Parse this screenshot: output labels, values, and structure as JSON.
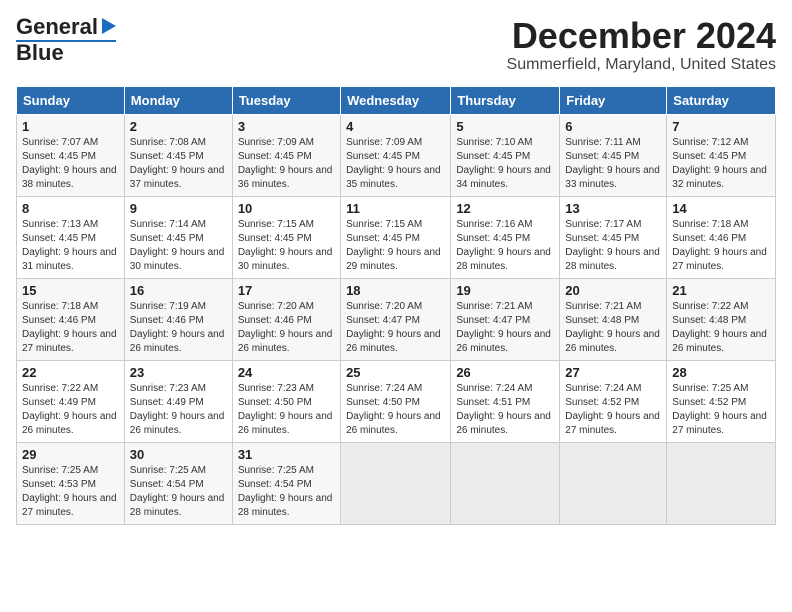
{
  "logo": {
    "line1": "General",
    "line2": "Blue"
  },
  "title": "December 2024",
  "location": "Summerfield, Maryland, United States",
  "days_of_week": [
    "Sunday",
    "Monday",
    "Tuesday",
    "Wednesday",
    "Thursday",
    "Friday",
    "Saturday"
  ],
  "weeks": [
    [
      {
        "num": "1",
        "sunrise": "7:07 AM",
        "sunset": "4:45 PM",
        "daylight": "9 hours and 38 minutes."
      },
      {
        "num": "2",
        "sunrise": "7:08 AM",
        "sunset": "4:45 PM",
        "daylight": "9 hours and 37 minutes."
      },
      {
        "num": "3",
        "sunrise": "7:09 AM",
        "sunset": "4:45 PM",
        "daylight": "9 hours and 36 minutes."
      },
      {
        "num": "4",
        "sunrise": "7:09 AM",
        "sunset": "4:45 PM",
        "daylight": "9 hours and 35 minutes."
      },
      {
        "num": "5",
        "sunrise": "7:10 AM",
        "sunset": "4:45 PM",
        "daylight": "9 hours and 34 minutes."
      },
      {
        "num": "6",
        "sunrise": "7:11 AM",
        "sunset": "4:45 PM",
        "daylight": "9 hours and 33 minutes."
      },
      {
        "num": "7",
        "sunrise": "7:12 AM",
        "sunset": "4:45 PM",
        "daylight": "9 hours and 32 minutes."
      }
    ],
    [
      {
        "num": "8",
        "sunrise": "7:13 AM",
        "sunset": "4:45 PM",
        "daylight": "9 hours and 31 minutes."
      },
      {
        "num": "9",
        "sunrise": "7:14 AM",
        "sunset": "4:45 PM",
        "daylight": "9 hours and 30 minutes."
      },
      {
        "num": "10",
        "sunrise": "7:15 AM",
        "sunset": "4:45 PM",
        "daylight": "9 hours and 30 minutes."
      },
      {
        "num": "11",
        "sunrise": "7:15 AM",
        "sunset": "4:45 PM",
        "daylight": "9 hours and 29 minutes."
      },
      {
        "num": "12",
        "sunrise": "7:16 AM",
        "sunset": "4:45 PM",
        "daylight": "9 hours and 28 minutes."
      },
      {
        "num": "13",
        "sunrise": "7:17 AM",
        "sunset": "4:45 PM",
        "daylight": "9 hours and 28 minutes."
      },
      {
        "num": "14",
        "sunrise": "7:18 AM",
        "sunset": "4:46 PM",
        "daylight": "9 hours and 27 minutes."
      }
    ],
    [
      {
        "num": "15",
        "sunrise": "7:18 AM",
        "sunset": "4:46 PM",
        "daylight": "9 hours and 27 minutes."
      },
      {
        "num": "16",
        "sunrise": "7:19 AM",
        "sunset": "4:46 PM",
        "daylight": "9 hours and 26 minutes."
      },
      {
        "num": "17",
        "sunrise": "7:20 AM",
        "sunset": "4:46 PM",
        "daylight": "9 hours and 26 minutes."
      },
      {
        "num": "18",
        "sunrise": "7:20 AM",
        "sunset": "4:47 PM",
        "daylight": "9 hours and 26 minutes."
      },
      {
        "num": "19",
        "sunrise": "7:21 AM",
        "sunset": "4:47 PM",
        "daylight": "9 hours and 26 minutes."
      },
      {
        "num": "20",
        "sunrise": "7:21 AM",
        "sunset": "4:48 PM",
        "daylight": "9 hours and 26 minutes."
      },
      {
        "num": "21",
        "sunrise": "7:22 AM",
        "sunset": "4:48 PM",
        "daylight": "9 hours and 26 minutes."
      }
    ],
    [
      {
        "num": "22",
        "sunrise": "7:22 AM",
        "sunset": "4:49 PM",
        "daylight": "9 hours and 26 minutes."
      },
      {
        "num": "23",
        "sunrise": "7:23 AM",
        "sunset": "4:49 PM",
        "daylight": "9 hours and 26 minutes."
      },
      {
        "num": "24",
        "sunrise": "7:23 AM",
        "sunset": "4:50 PM",
        "daylight": "9 hours and 26 minutes."
      },
      {
        "num": "25",
        "sunrise": "7:24 AM",
        "sunset": "4:50 PM",
        "daylight": "9 hours and 26 minutes."
      },
      {
        "num": "26",
        "sunrise": "7:24 AM",
        "sunset": "4:51 PM",
        "daylight": "9 hours and 26 minutes."
      },
      {
        "num": "27",
        "sunrise": "7:24 AM",
        "sunset": "4:52 PM",
        "daylight": "9 hours and 27 minutes."
      },
      {
        "num": "28",
        "sunrise": "7:25 AM",
        "sunset": "4:52 PM",
        "daylight": "9 hours and 27 minutes."
      }
    ],
    [
      {
        "num": "29",
        "sunrise": "7:25 AM",
        "sunset": "4:53 PM",
        "daylight": "9 hours and 27 minutes."
      },
      {
        "num": "30",
        "sunrise": "7:25 AM",
        "sunset": "4:54 PM",
        "daylight": "9 hours and 28 minutes."
      },
      {
        "num": "31",
        "sunrise": "7:25 AM",
        "sunset": "4:54 PM",
        "daylight": "9 hours and 28 minutes."
      },
      null,
      null,
      null,
      null
    ]
  ]
}
